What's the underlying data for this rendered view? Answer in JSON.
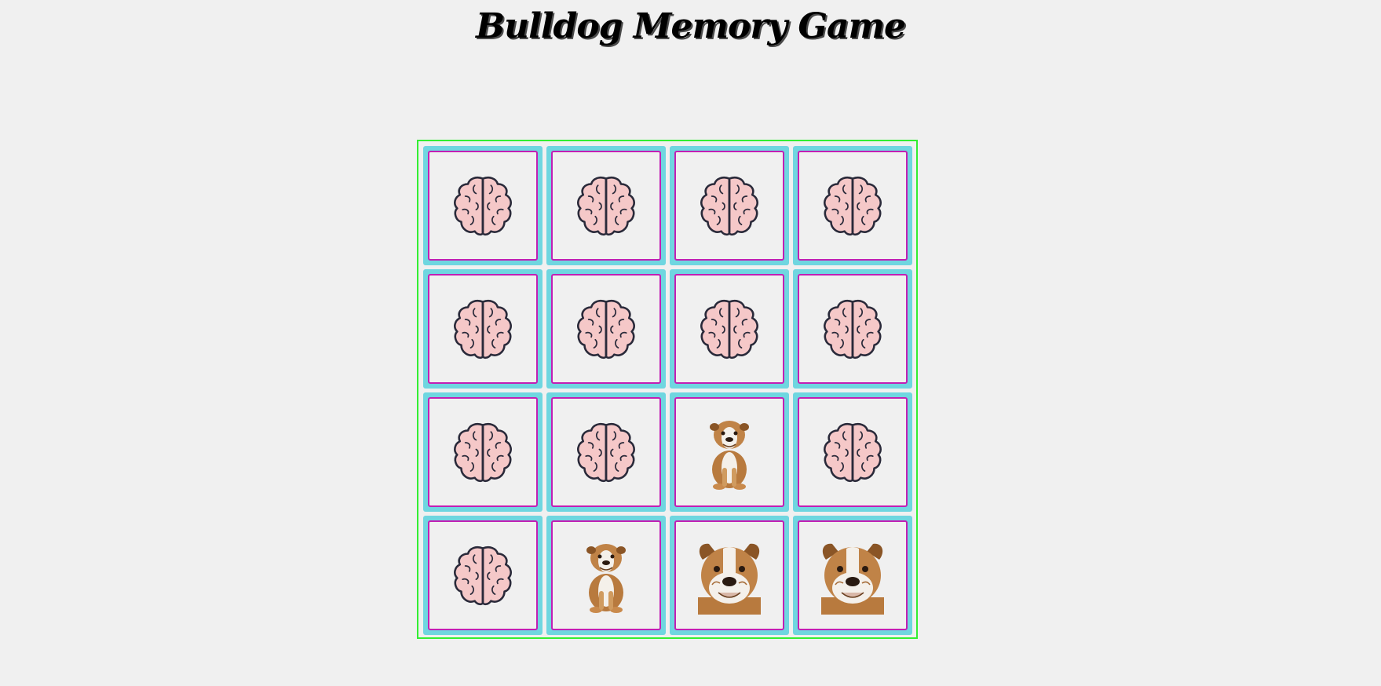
{
  "page": {
    "title": "Bulldog Memory Game"
  },
  "colors": {
    "background": "#f0f0f0",
    "board_border": "#33ee33",
    "card_frame": "#6fd6e0",
    "card_border": "#c21fb4",
    "brain_fill": "#f5c8c8",
    "brain_stroke": "#2a2a3a"
  },
  "board": {
    "rows": 4,
    "columns": 4,
    "cards": [
      {
        "face": "brain-icon",
        "state": "hidden"
      },
      {
        "face": "brain-icon",
        "state": "hidden"
      },
      {
        "face": "brain-icon",
        "state": "hidden"
      },
      {
        "face": "brain-icon",
        "state": "hidden"
      },
      {
        "face": "brain-icon",
        "state": "hidden"
      },
      {
        "face": "brain-icon",
        "state": "hidden"
      },
      {
        "face": "brain-icon",
        "state": "hidden"
      },
      {
        "face": "brain-icon",
        "state": "hidden"
      },
      {
        "face": "brain-icon",
        "state": "hidden"
      },
      {
        "face": "brain-icon",
        "state": "hidden"
      },
      {
        "face": "bulldog-sitting-icon",
        "state": "revealed"
      },
      {
        "face": "brain-icon",
        "state": "hidden"
      },
      {
        "face": "brain-icon",
        "state": "hidden"
      },
      {
        "face": "bulldog-sitting-icon",
        "state": "revealed"
      },
      {
        "face": "bulldog-face-icon",
        "state": "revealed"
      },
      {
        "face": "bulldog-face-icon",
        "state": "revealed"
      }
    ]
  }
}
